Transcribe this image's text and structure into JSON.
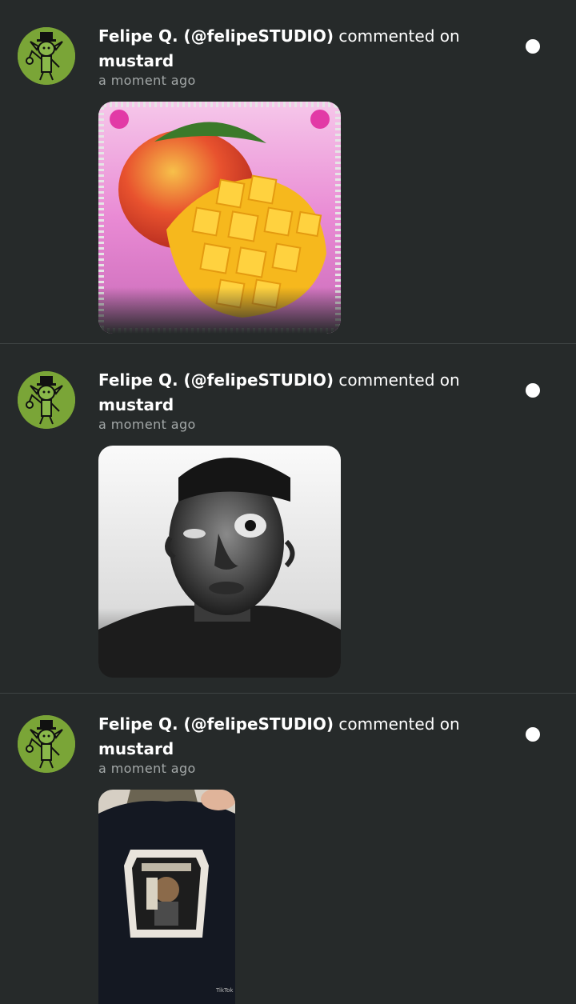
{
  "notifications": [
    {
      "user_name": "Felipe Q. (@felipeSTUDIO)",
      "action": "commented on",
      "target": "mustard",
      "time": "a moment ago",
      "avatar_icon": "green-mascot-avatar",
      "media_description_icon": "mango-image"
    },
    {
      "user_name": "Felipe Q. (@felipeSTUDIO)",
      "action": "commented on",
      "target": "mustard",
      "time": "a moment ago",
      "avatar_icon": "green-mascot-avatar",
      "media_description_icon": "face-photo-image"
    },
    {
      "user_name": "Felipe Q. (@felipeSTUDIO)",
      "action": "commented on",
      "target": "mustard",
      "time": "a moment ago",
      "avatar_icon": "green-mascot-avatar",
      "media_description_icon": "shirt-photo-image",
      "media_watermark": "TikTok"
    }
  ],
  "colors": {
    "background": "#262a2a",
    "text": "#ffffff",
    "muted": "#a3a8a8",
    "avatar": "#7aa537",
    "divider": "#3e4343"
  }
}
